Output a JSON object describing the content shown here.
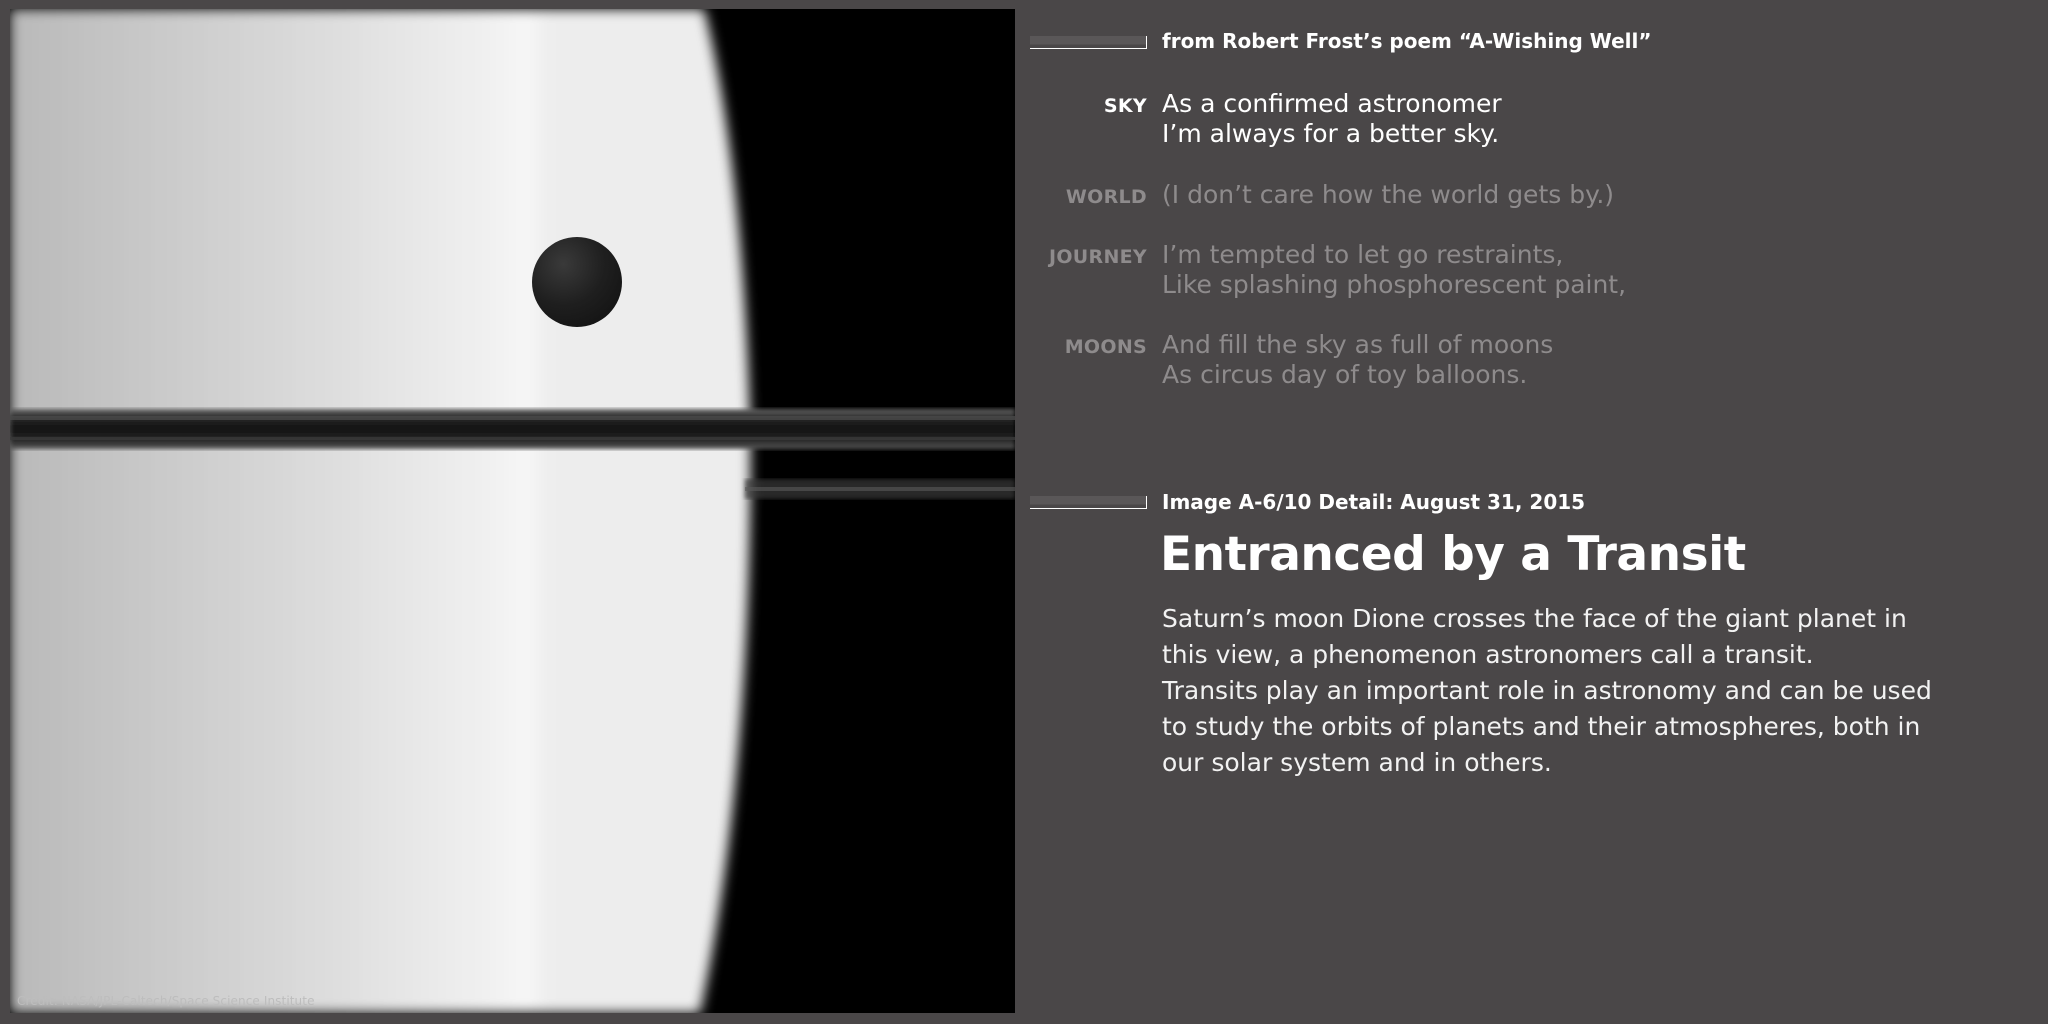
{
  "photo": {
    "credit": "Credit: NASA/JPL-Caltech/Space Science Institute"
  },
  "poem": {
    "source": "from Robert Frost’s poem “A-Wishing Well”",
    "stanzas": [
      {
        "keyword": "SKY",
        "state": "active",
        "lines": [
          "As a confirmed astronomer",
          "I’m always for a better sky."
        ]
      },
      {
        "keyword": "WORLD",
        "state": "dim",
        "lines": [
          "(I don’t care how the world gets by.)"
        ]
      },
      {
        "keyword": "JOURNEY",
        "state": "dim",
        "lines": [
          "I’m tempted to let go restraints,",
          "Like splashing phosphorescent paint,"
        ]
      },
      {
        "keyword": "MOONS",
        "state": "dim",
        "lines": [
          "And fill the sky as full of moons",
          "As circus day of toy balloons."
        ]
      }
    ]
  },
  "article": {
    "image_detail": "Image A-6/10 Detail: August 31, 2015",
    "title": "Entranced by a Transit",
    "description_lines": [
      "Saturn’s moon Dione crosses the face of the giant planet in",
      "this view, a phenomenon astronomers call a transit.",
      "Transits play an important role in astronomy and can be used",
      "to study the orbits of planets and their atmospheres, both in",
      "our solar system and in others."
    ]
  },
  "colors": {
    "background": "#4a4748",
    "text_active": "#ffffff",
    "text_dim": "#8e8b8c"
  }
}
